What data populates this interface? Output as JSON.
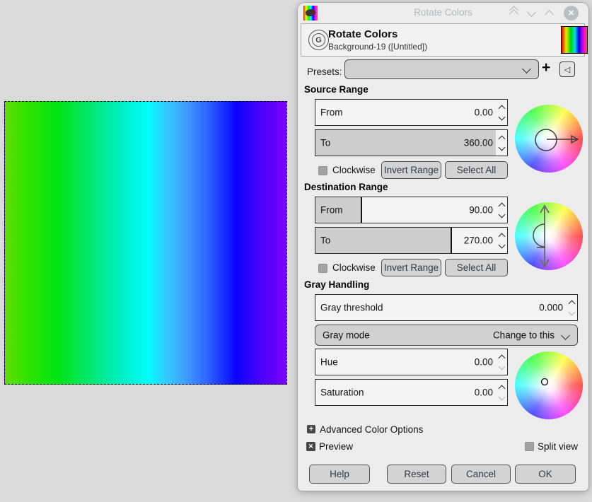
{
  "window": {
    "title": "Rotate Colors"
  },
  "header": {
    "title": "Rotate Colors",
    "subtitle": "Background-19 ([Untitled])"
  },
  "presets": {
    "label": "Presets:",
    "value": ""
  },
  "source_range": {
    "heading": "Source Range",
    "from_label": "From",
    "from_value": "0.00",
    "to_label": "To",
    "to_value": "360.00",
    "clockwise_label": "Clockwise",
    "invert_label": "Invert Range",
    "select_all_label": "Select All"
  },
  "destination_range": {
    "heading": "Destination Range",
    "from_label": "From",
    "from_value": "90.00",
    "to_label": "To",
    "to_value": "270.00",
    "clockwise_label": "Clockwise",
    "invert_label": "Invert Range",
    "select_all_label": "Select All"
  },
  "gray_handling": {
    "heading": "Gray Handling",
    "threshold_label": "Gray threshold",
    "threshold_value": "0.000",
    "mode_label": "Gray mode",
    "mode_value": "Change to this",
    "hue_label": "Hue",
    "hue_value": "0.00",
    "saturation_label": "Saturation",
    "saturation_value": "0.00"
  },
  "advanced_label": "Advanced Color Options",
  "preview_label": "Preview",
  "split_view_label": "Split view",
  "actions": {
    "help": "Help",
    "reset": "Reset",
    "cancel": "Cancel",
    "ok": "OK"
  },
  "icons": {
    "add_preset": "+",
    "import_preset": "◁",
    "expander_plus": "+",
    "checkbox_x": "✕",
    "close": "✕",
    "logo": "G"
  },
  "colors": {
    "dialog_bg": "#ececec",
    "canvas_bg": "#d9dad9",
    "spin_fill": "#cdcdcd",
    "ants_yellow": "#f2ef49"
  },
  "canvas_gradient": [
    {
      "pos": 0,
      "color": "#60de00"
    },
    {
      "pos": 9,
      "color": "#2ae300"
    },
    {
      "pos": 19,
      "color": "#00e414"
    },
    {
      "pos": 30,
      "color": "#00e76e"
    },
    {
      "pos": 40,
      "color": "#00eeba"
    },
    {
      "pos": 51,
      "color": "#00fdfd"
    },
    {
      "pos": 57,
      "color": "#31ccff"
    },
    {
      "pos": 64,
      "color": "#3f9eff"
    },
    {
      "pos": 73,
      "color": "#2c5cff"
    },
    {
      "pos": 82,
      "color": "#0a04ff"
    },
    {
      "pos": 91,
      "color": "#4a02fa"
    },
    {
      "pos": 100,
      "color": "#7b00ff"
    }
  ]
}
